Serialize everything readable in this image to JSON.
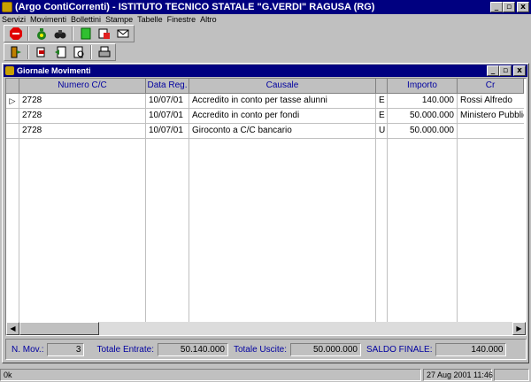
{
  "window": {
    "title": "(Argo ContiCorrenti) - ISTITUTO TECNICO STATALE \"G.VERDI\" RAGUSA (RG)",
    "minimize": "_",
    "restore": "▫",
    "close": "x"
  },
  "menu": [
    "Servizi",
    "Movimenti",
    "Bollettini",
    "Stampe",
    "Tabelle",
    "Finestre",
    "Altro"
  ],
  "toolbar1": [
    "stop-icon",
    "money-bag-icon",
    "binoculars-icon",
    "green-doc-icon",
    "red-doc-icon",
    "envelope-icon"
  ],
  "toolbar2": [
    "exit-door-icon",
    "bookmark-icon",
    "back-doc-icon",
    "preview-doc-icon",
    "printer-icon"
  ],
  "child": {
    "title": "Giornale Movimenti"
  },
  "grid": {
    "columns": [
      "Numero C/C",
      "Data Reg.",
      "Causale",
      "",
      "Importo",
      "Cr"
    ],
    "rows": [
      [
        "2728",
        "10/07/01",
        "Accredito in conto per tasse alunni",
        "E",
        "140.000",
        "Rossi Alfredo"
      ],
      [
        "2728",
        "10/07/01",
        "Accredito in conto per fondi",
        "E",
        "50.000.000",
        "Ministero Pubblic"
      ],
      [
        "2728",
        "10/07/01",
        "Giroconto a C/C bancario",
        "U",
        "50.000.000",
        ""
      ]
    ]
  },
  "totals": {
    "n_mov_label": "N. Mov.:",
    "n_mov": "3",
    "entrate_label": "Totale Entrate:",
    "entrate": "50.140.000",
    "uscite_label": "Totale Uscite:",
    "uscite": "50.000.000",
    "saldo_label": "SALDO FINALE:",
    "saldo": "140.000"
  },
  "status": {
    "left": "0k",
    "datetime": "27 Aug 2001 11:46"
  },
  "colors": {
    "titlebar": "#000080",
    "face": "#c0c0c0",
    "label": "#0000a0"
  }
}
